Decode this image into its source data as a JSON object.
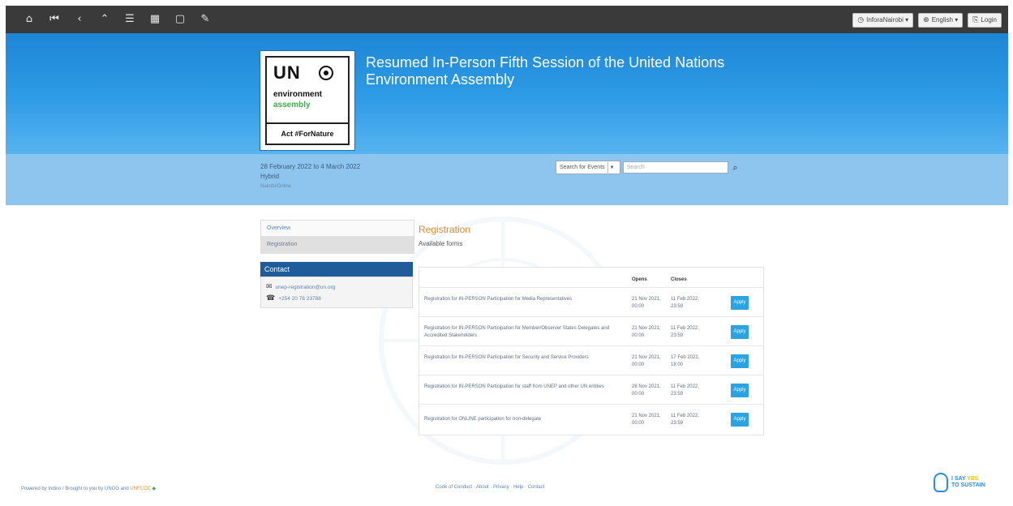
{
  "toolbar": {
    "icons": [
      "home-icon",
      "first-page-icon",
      "back-icon",
      "up-icon",
      "list-icon",
      "calendar-icon",
      "window-icon",
      "edit-icon"
    ],
    "glyphs": [
      "⌂",
      "⏮",
      "‹",
      "⌃",
      "☰",
      "▦",
      "▢",
      "✎"
    ],
    "account_label": "InforaNairobi",
    "language_label": "English",
    "login_label": "Login"
  },
  "banner": {
    "logo": {
      "un": "UN",
      "env": "environment",
      "asm": "assembly",
      "act": "Act #ForNature"
    },
    "title": "Resumed In-Person Fifth Session of the United Nations Environment Assembly"
  },
  "subbanner": {
    "dates": "28 February 2022 to 4 March 2022",
    "location": "Hybrid",
    "small": "Nairobi/Online"
  },
  "search": {
    "scope_label": "Search for Events",
    "placeholder": "Search",
    "button_glyph": "⌕"
  },
  "menu": {
    "items": [
      {
        "label": "Overview",
        "active": false
      },
      {
        "label": "Registration",
        "active": true
      }
    ]
  },
  "contact": {
    "heading": "Contact",
    "email": "unep-registration@un.org",
    "phone": "+254 20 76 23788",
    "email_icon": "✉",
    "phone_icon": "☎"
  },
  "registration": {
    "title": "Registration",
    "subtitle": "Available forms",
    "columns": {
      "name": "",
      "opens": "Opens",
      "closes": "Closes",
      "action": ""
    },
    "rows": [
      {
        "name": "Registration for IN-PERSON Participation for Media Representatives",
        "opens": "21 Nov 2021, 00:00",
        "closes": "11 Feb 2022, 23:59",
        "action": "Apply"
      },
      {
        "name": "Registration for IN-PERSON Participation for Member/Observer States Delegates and Accredited Stakeholders",
        "opens": "21 Nov 2021, 00:00",
        "closes": "11 Feb 2022, 23:59",
        "action": "Apply"
      },
      {
        "name": "Registration for IN-PERSON Participation for Security and Service Providers",
        "opens": "21 Nov 2021, 00:00",
        "closes": "17 Feb 2022, 18:00",
        "action": "Apply"
      },
      {
        "name": "Registration for IN-PERSON Participation for staff from UNEP and other UN entities",
        "opens": "28 Nov 2021, 00:00",
        "closes": "11 Feb 2022, 23:59",
        "action": "Apply"
      },
      {
        "name": "Registration for ONLINE participation for non-delegate",
        "opens": "21 Nov 2021, 00:00",
        "closes": "11 Feb 2022, 23:59",
        "action": "Apply"
      }
    ]
  },
  "footer": {
    "left": "Powered by Indico / Brought to you by UNOG and",
    "left_brand": "UNFCCC",
    "center": "Code of Conduct · About · Privacy · Help · Contact",
    "logo_line1": "I SAY",
    "logo_line1b": "YES",
    "logo_line2": "TO SUSTAIN"
  }
}
